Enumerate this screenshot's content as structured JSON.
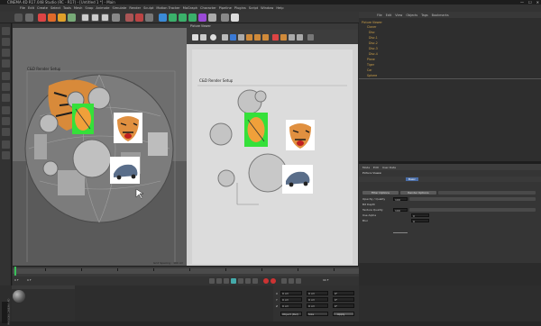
{
  "window": {
    "title": "CINEMA 4D R17.048 Studio (RC - R17) - [Untitled 1 *] - Main",
    "controls": [
      "—",
      "☐",
      "✕"
    ]
  },
  "menubar": {
    "items": [
      "File",
      "Edit",
      "Create",
      "Select",
      "Tools",
      "Mesh",
      "Snap",
      "Animate",
      "Simulate",
      "Render",
      "Sculpt",
      "Motion Tracker",
      "MoGraph",
      "Character",
      "Pipeline",
      "Plugins",
      "Script",
      "Window",
      "Help"
    ]
  },
  "object_manager": {
    "menu": [
      "File",
      "Edit",
      "View",
      "Objects",
      "Tags",
      "Bookmarks"
    ],
    "objects": [
      "Picture Viewer",
      "Cloner",
      "Disc",
      "Disc.1",
      "Disc.2",
      "Disc.3",
      "Disc.4",
      "Plane",
      "Tiger",
      "Car",
      "Sphere"
    ]
  },
  "viewport": {
    "label": "C&D Render Setup",
    "footer": "Grid Spacing : 100 cm"
  },
  "picture_viewer": {
    "label": "C&D Render Setup",
    "tabs": [
      "Picture Viewer"
    ]
  },
  "attributes": {
    "tabs": [
      "Mode",
      "Edit",
      "User Data"
    ],
    "header": "Picture Viewer",
    "subtab": "Basic",
    "buttons": [
      "Filter Options",
      "Render Options"
    ],
    "fields": [
      {
        "label": "Opacity / Quality",
        "value": "100"
      },
      {
        "label": "Bit Depth",
        "value": ""
      },
      {
        "label": "Texture Quality",
        "value": "100"
      },
      {
        "label": "Use Alpha",
        "value": "0"
      },
      {
        "label": "Blur",
        "value": "0"
      }
    ]
  },
  "coordinates": {
    "rows": [
      {
        "axis": "X",
        "pos": "0 cm",
        "size": "0 cm",
        "rot": "0°"
      },
      {
        "axis": "Y",
        "pos": "0 cm",
        "size": "0 cm",
        "rot": "0°"
      },
      {
        "axis": "Z",
        "pos": "0 cm",
        "size": "0 cm",
        "rot": "0°"
      }
    ],
    "mode_a": "Object (Rel)",
    "mode_b": "Size",
    "apply": "Apply"
  },
  "timeline": {
    "start": "0 F",
    "end": "90 F",
    "current": "0 F"
  },
  "colors": {
    "accent_green": "#35e03a",
    "orange": "#f0a03a",
    "object_name": "#cfa24a"
  },
  "branding": "MAXON CINEMA 4D"
}
